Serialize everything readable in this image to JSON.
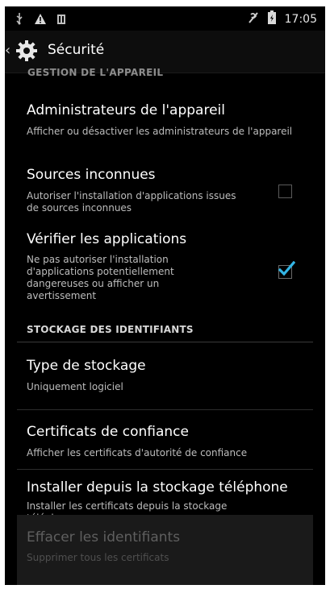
{
  "status_bar": {
    "time": "17:05",
    "icons": [
      "usb-icon",
      "warning-icon",
      "notification-icon",
      "signal-off-icon",
      "battery-icon"
    ]
  },
  "action_bar": {
    "title": "Sécurité",
    "icon": "settings-gear-icon"
  },
  "content": {
    "partial_section_header": "GESTION DE L'APPAREIL",
    "items": [
      {
        "title": "Administrateurs de l'appareil",
        "summary": "Afficher ou désactiver les administrateurs de l'appareil"
      },
      {
        "title": "Sources inconnues",
        "summary": "Autoriser l'installation d'applications issues de sources inconnues",
        "checked": false
      },
      {
        "title": "Vérifier les applications",
        "summary": "Ne pas autoriser l'installation d'applications potentiellement dangereuses ou afficher un avertissement",
        "checked": true
      }
    ],
    "section_header": "STOCKAGE DES IDENTIFIANTS",
    "storage_items": [
      {
        "title": "Type de stockage",
        "summary": "Uniquement logiciel"
      },
      {
        "title": "Certificats de confiance",
        "summary": "Afficher les certificats d'autorité de confiance"
      },
      {
        "title": "Installer depuis la stockage téléphone",
        "summary": "Installer les certificats depuis la stockage téléphone"
      },
      {
        "title": "Effacer les identifiants",
        "summary": "Supprimer tous les certificats",
        "enabled": false
      }
    ]
  },
  "colors": {
    "accent": "#33b5e5",
    "background": "#000000",
    "text_primary": "#ffffff",
    "text_secondary": "#bdbdbd"
  }
}
